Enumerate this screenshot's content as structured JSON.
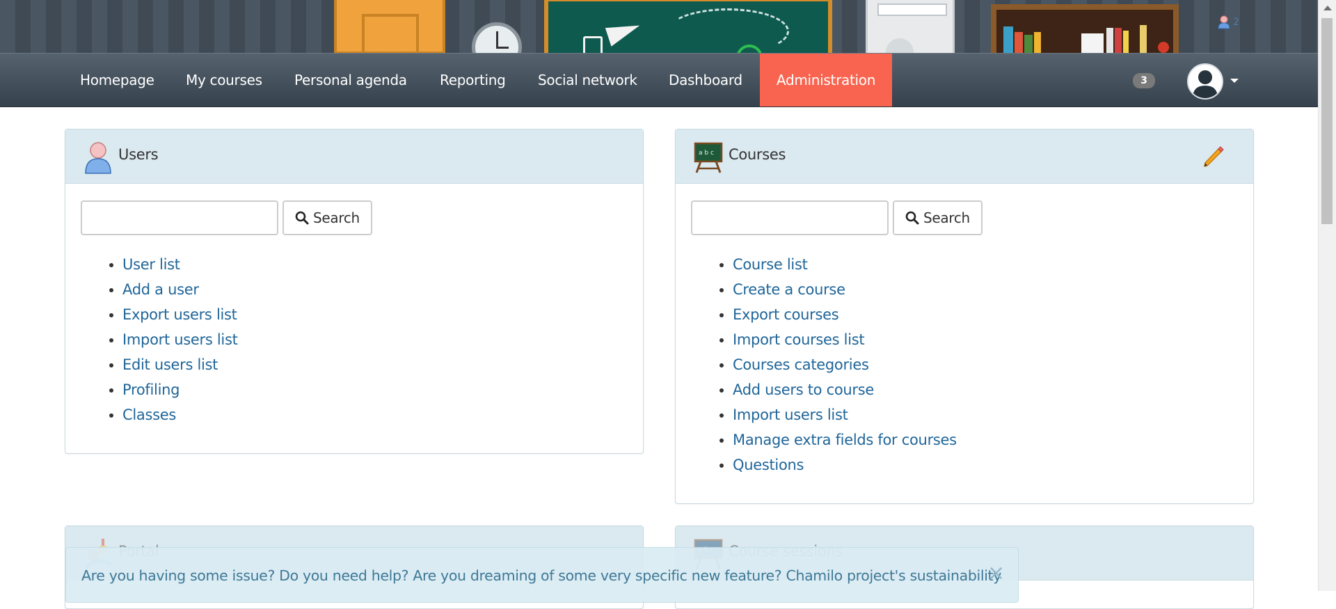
{
  "header": {
    "online_count": "2"
  },
  "nav": {
    "items": [
      {
        "label": "Homepage"
      },
      {
        "label": "My courses"
      },
      {
        "label": "Personal agenda"
      },
      {
        "label": "Reporting"
      },
      {
        "label": "Social network"
      },
      {
        "label": "Dashboard"
      },
      {
        "label": "Administration",
        "active": true
      }
    ],
    "notification_count": "3"
  },
  "users_panel": {
    "title": "Users",
    "search_placeholder": "",
    "search_label": "Search",
    "links": [
      "User list",
      "Add a user",
      "Export users list",
      "Import users list",
      "Edit users list",
      "Profiling",
      "Classes"
    ]
  },
  "courses_panel": {
    "title": "Courses",
    "search_placeholder": "",
    "search_label": "Search",
    "links": [
      "Course list",
      "Create a course",
      "Export courses",
      "Import courses list",
      "Courses categories",
      "Add users to course",
      "Import users list",
      "Manage extra fields for courses",
      "Questions"
    ]
  },
  "portal_panel": {
    "title": "Portal"
  },
  "sessions_panel": {
    "title": "Course sessions"
  },
  "help_alert": {
    "text": "Are you having some issue? Do you need help? Are you dreaming of some very specific new feature? Chamilo project's sustainability",
    "close_label": "×"
  },
  "colors": {
    "navbar": "#3f4b56",
    "active_nav": "#f8644f",
    "panel_heading": "#dbeaf0",
    "link": "#1f6599",
    "badge": "#7a7a7a"
  }
}
